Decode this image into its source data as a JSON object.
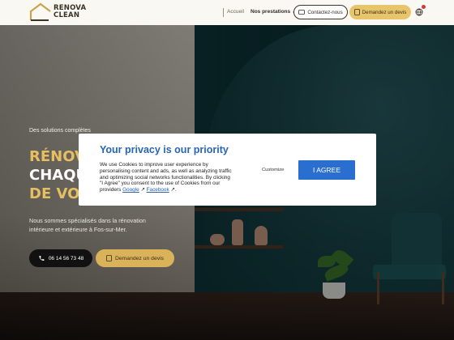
{
  "header": {
    "logo_line1": "RENOVA",
    "logo_line2": "CLEAN",
    "nav_home": "Accueil",
    "nav_services": "Nos prestations",
    "contact_button": "Contactez-nous",
    "quote_button": "Demandez un devis"
  },
  "hero": {
    "tagline": "Des solutions complètes",
    "title_line1": "RÉNOVO",
    "title_line2": "CHAQUE",
    "title_line3": "DE VOT",
    "description": "Nous sommes spécialisés dans la rénovation intérieure et extérieure à Fos-sur-Mer.",
    "phone_button": "06 14 56 73 48",
    "quote_button": "Demandez un devis"
  },
  "cookie_modal": {
    "title": "Your privacy is our priority",
    "body": "We use Cookies to improve user experience by personalising content and ads, as well as analyzing traffic and optimizing social networks functionalities. By clicking \"I Agree\" you consent to the use of Cookies from our providers",
    "link_google": "Google",
    "link_facebook": "Facebook",
    "customize_label": "Customize",
    "agree_label": "I AGREE"
  },
  "colors": {
    "gold": "#e7bf60",
    "primary_blue": "#2765b8",
    "agree_blue": "#2a6fd0",
    "teal_wall": "#0f3a40"
  }
}
